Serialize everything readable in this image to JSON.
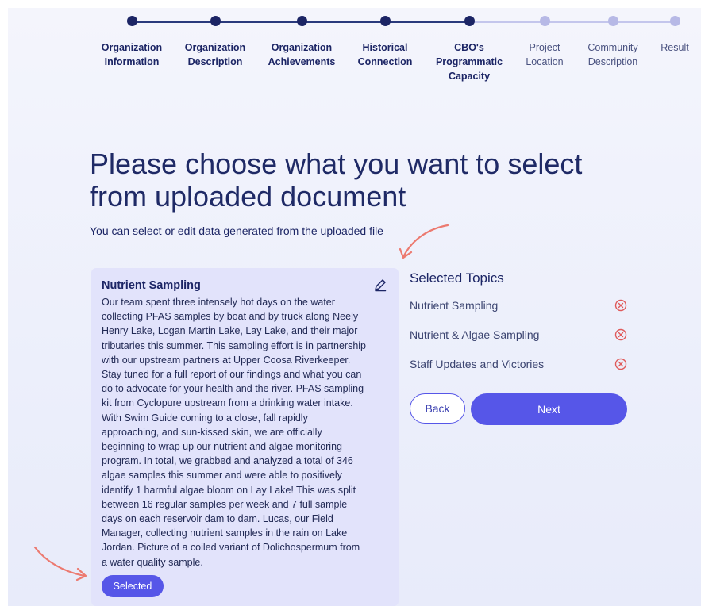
{
  "stepper": {
    "steps": [
      {
        "label": "Organization Information",
        "state": "done"
      },
      {
        "label": "Organization Description",
        "state": "done"
      },
      {
        "label": "Organization Achievements",
        "state": "done"
      },
      {
        "label": "Historical Connection",
        "state": "done"
      },
      {
        "label": "CBO's Programmatic Capacity",
        "state": "done"
      },
      {
        "label": "Project Location",
        "state": "todo"
      },
      {
        "label": "Community Description",
        "state": "todo"
      },
      {
        "label": "Result",
        "state": "todo"
      }
    ]
  },
  "header": {
    "title": "Please choose what you want to select from uploaded document",
    "subtitle": "You can select or edit data generated from the uploaded file"
  },
  "card": {
    "title": "Nutrient Sampling",
    "body": "Our team spent three intensely hot days on the water collecting PFAS samples by boat and by truck along Neely Henry Lake, Logan Martin Lake, Lay Lake, and their major tributaries this summer. This sampling effort is in partnership with our upstream partners at Upper Coosa Riverkeeper. Stay tuned for a full report of our findings and what you can do to advocate for your health and the river. PFAS sampling kit from Cyclopure upstream from a drinking water intake. With Swim Guide coming to a close, fall rapidly approaching, and sun-kissed skin, we are officially beginning to wrap up our nutrient and algae monitoring program. In total, we grabbed and analyzed a total of 346 algae samples this summer and were able to positively identify 1 harmful algae bloom on Lay Lake! This was split between 16 regular samples per week and 7 full sample days on each reservoir dam to dam. Lucas, our Field Manager, collecting nutrient samples in the rain on Lake Jordan. Picture of a coiled variant of Dolichospermum from a water quality sample.",
    "selected_label": "Selected",
    "edit_icon": "pencil-icon"
  },
  "topics": {
    "title": "Selected Topics",
    "items": [
      {
        "label": "Nutrient Sampling"
      },
      {
        "label": "Nutrient & Algae Sampling"
      },
      {
        "label": "Staff Updates and Victories"
      }
    ],
    "remove_icon": "close-circle-icon"
  },
  "actions": {
    "back_label": "Back",
    "next_label": "Next"
  },
  "colors": {
    "accent": "#5656e8",
    "step_done": "#1c2565",
    "step_todo": "#b7b9e6",
    "remove": "#e05a5a",
    "annotation_arrow": "#ec7a70"
  }
}
